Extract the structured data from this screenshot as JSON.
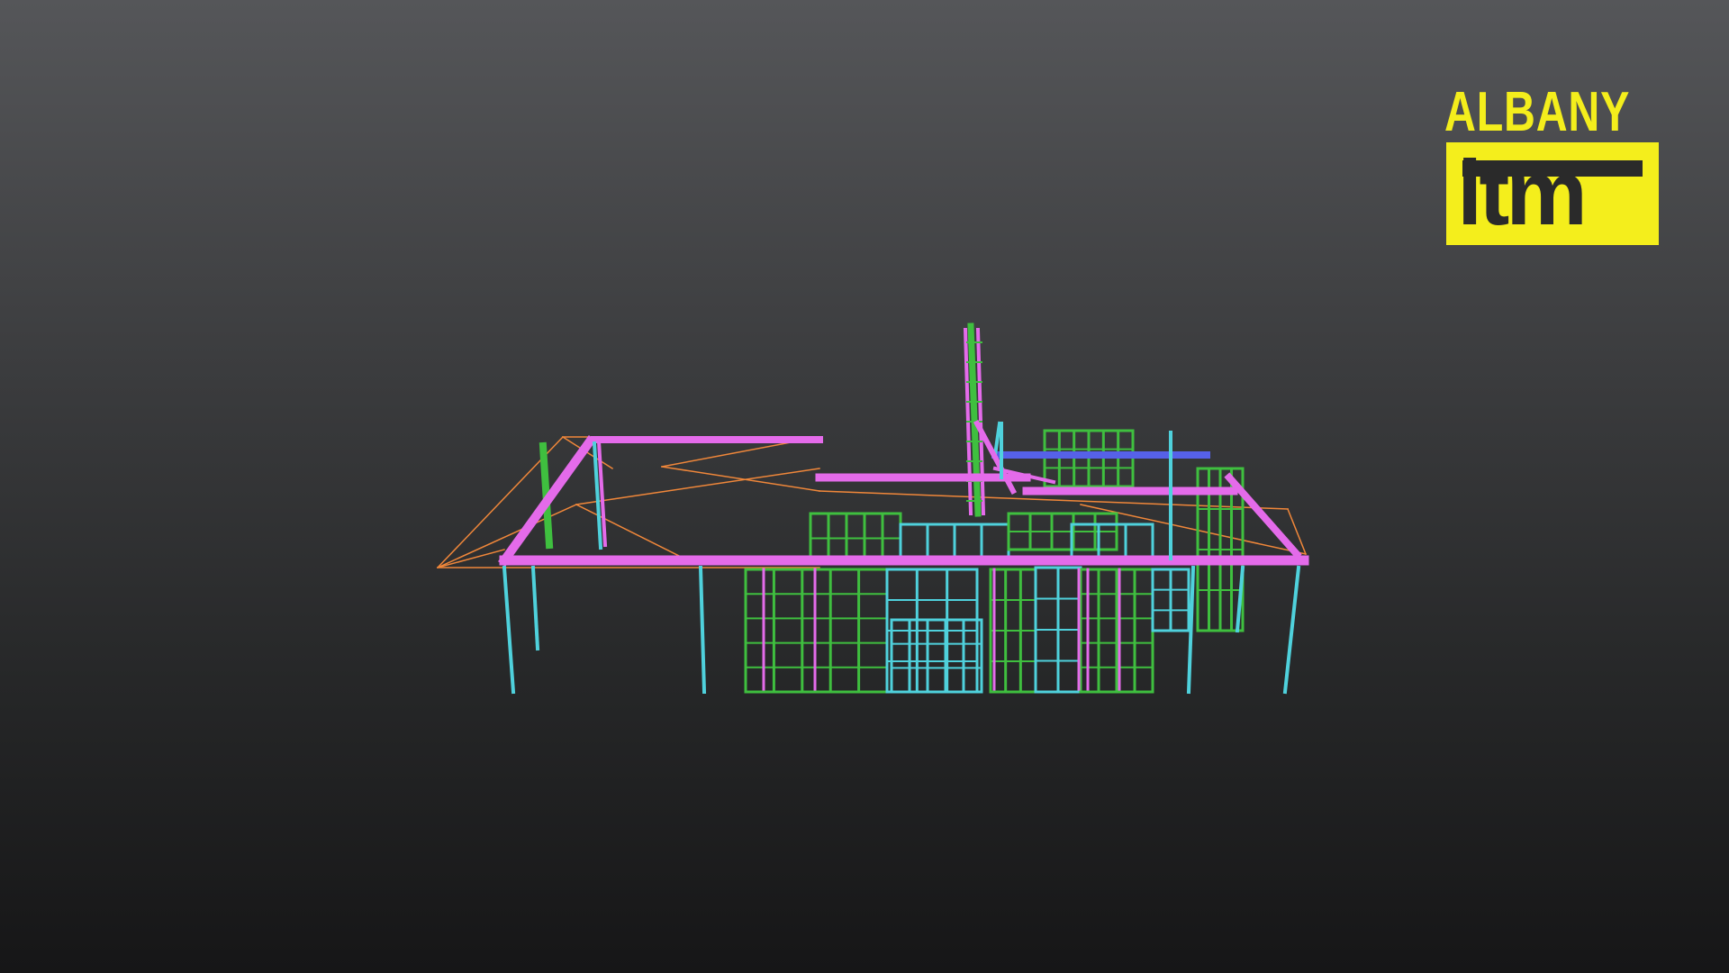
{
  "logo": {
    "word": "ALBANY",
    "mark": "itm",
    "color": "#f4ee1c"
  },
  "viewer": {
    "background_top": "#555659",
    "background_bottom": "#161617"
  },
  "model": {
    "colors": {
      "beam": "#e46bea",
      "stud": "#4fd1dc",
      "frame": "#3fbf3f",
      "roof": "#f0873a",
      "lintel": "#5661e8"
    }
  }
}
